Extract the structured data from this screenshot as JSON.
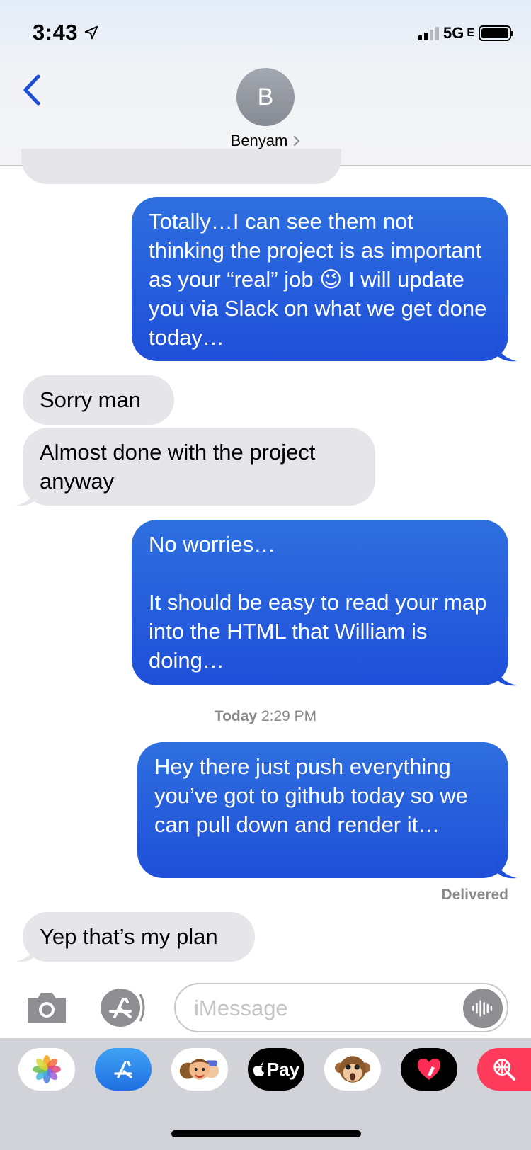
{
  "status_bar": {
    "time": "3:43",
    "network": "5G",
    "network_sub": "E"
  },
  "header": {
    "avatar_initial": "B",
    "contact_name": "Benyam"
  },
  "messages": [
    {
      "direction": "outgoing",
      "text": "Totally…I can see them not thinking the project is as important as your “real” job 😉 I will update you via Slack on what we get done today…"
    },
    {
      "direction": "incoming",
      "text": "Sorry man"
    },
    {
      "direction": "incoming",
      "text": "Almost done with the project anyway"
    },
    {
      "direction": "outgoing",
      "text": "No worries…\n\nIt should be easy to read your map into the HTML that William is doing…"
    },
    {
      "direction": "outgoing",
      "text": "Hey there just push everything you’ve got to github today so we can pull down and render it…"
    },
    {
      "direction": "incoming",
      "text": "Yep that’s my plan"
    }
  ],
  "timestamp": {
    "day": "Today",
    "time": "2:29 PM"
  },
  "delivered_label": "Delivered",
  "input": {
    "placeholder": "iMessage"
  },
  "colors": {
    "outgoing_bubble": "#2563dc",
    "incoming_bubble": "#e5e5ea",
    "back_chevron": "#1d4ed8",
    "drawer_background": "#d2d3d8"
  },
  "app_drawer": [
    {
      "name": "photos-app-icon"
    },
    {
      "name": "app-store-icon"
    },
    {
      "name": "memoji-icon"
    },
    {
      "name": "apple-pay-icon",
      "label": "Pay"
    },
    {
      "name": "animoji-monkey-icon"
    },
    {
      "name": "digital-touch-icon"
    },
    {
      "name": "web-images-search-icon"
    }
  ]
}
